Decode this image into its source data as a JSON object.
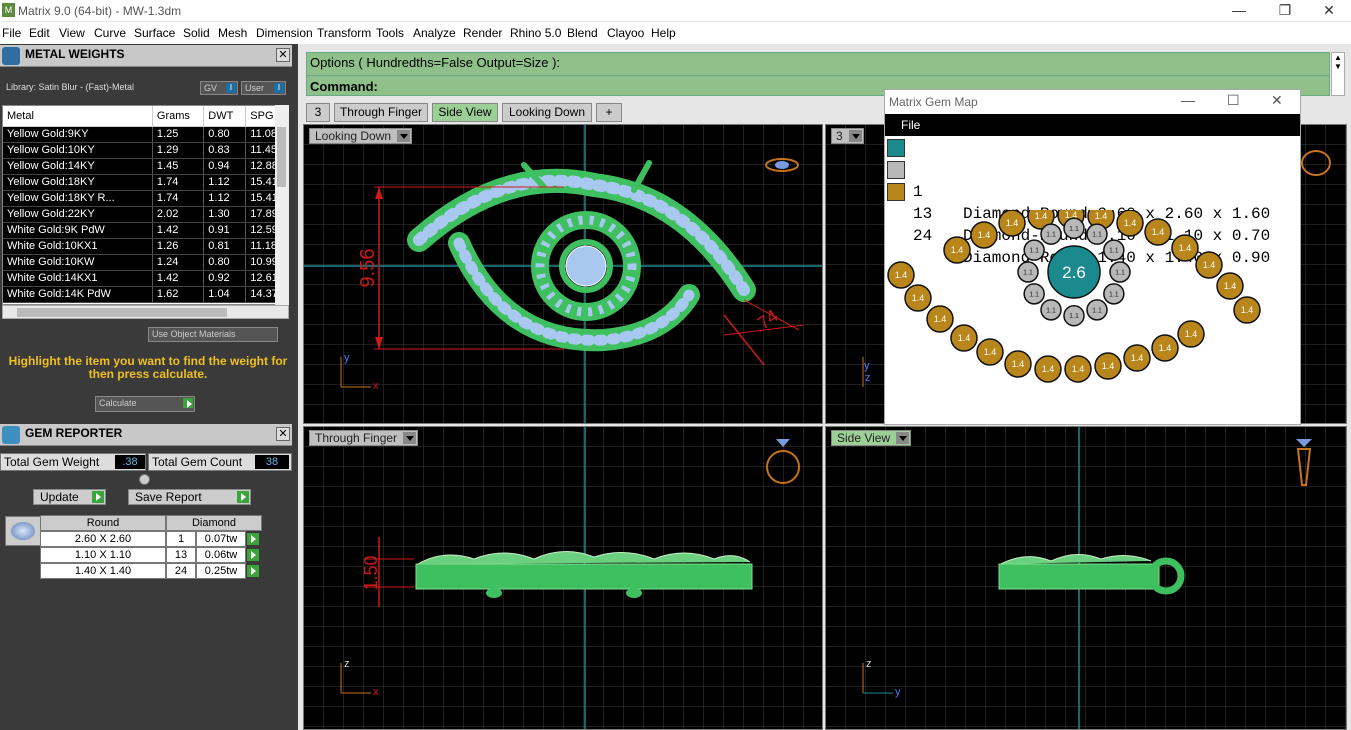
{
  "window": {
    "title": "Matrix 9.0 (64-bit) - MW-1.3dm",
    "minimize": "—",
    "restore": "❐",
    "close": "✕"
  },
  "menu": [
    "File",
    "Edit",
    "View",
    "Curve",
    "Surface",
    "Solid",
    "Mesh",
    "Dimension",
    "Transform",
    "Tools",
    "Analyze",
    "Render",
    "Rhino 5.0",
    "Blend",
    "Clayoo",
    "Help"
  ],
  "metal_panel": {
    "title": "METAL WEIGHTS",
    "library": "Library: Satin Blur - (Fast)-Metal",
    "gv": "GV",
    "user": "User",
    "toggle": "I",
    "columns": [
      "Metal",
      "Grams",
      "DWT",
      "SPG"
    ],
    "rows": [
      [
        "Yellow Gold:9KY",
        "1.25",
        "0.80",
        "11.08"
      ],
      [
        "Yellow Gold:10KY",
        "1.29",
        "0.83",
        "11.45"
      ],
      [
        "Yellow Gold:14KY",
        "1.45",
        "0.94",
        "12.88"
      ],
      [
        "Yellow Gold:18KY",
        "1.74",
        "1.12",
        "15.41"
      ],
      [
        "Yellow Gold:18KY R...",
        "1.74",
        "1.12",
        "15.41"
      ],
      [
        "Yellow Gold:22KY",
        "2.02",
        "1.30",
        "17.89"
      ],
      [
        "White Gold:9K PdW",
        "1.42",
        "0.91",
        "12.59"
      ],
      [
        "White Gold:10KX1",
        "1.26",
        "0.81",
        "11.18"
      ],
      [
        "White Gold:10KW",
        "1.24",
        "0.80",
        "10.99"
      ],
      [
        "White Gold:14KX1",
        "1.42",
        "0.92",
        "12.61"
      ],
      [
        "White Gold:14K PdW",
        "1.62",
        "1.04",
        "14.37"
      ]
    ],
    "use_object_materials": "Use Object Materials",
    "hint": "Highlight the item you want to find the weight for then press calculate.",
    "calculate": "Calculate"
  },
  "gem_panel": {
    "title": "GEM REPORTER",
    "total_weight_label": "Total Gem Weight",
    "total_weight": ".38",
    "total_count_label": "Total Gem Count",
    "total_count": "38",
    "update": "Update",
    "save_report": "Save Report",
    "head_shape": "Round",
    "head_type": "Diamond",
    "rows": [
      {
        "size": "2.60 X 2.60",
        "count": "1",
        "weight": "0.07tw"
      },
      {
        "size": "1.10 X 1.10",
        "count": "13",
        "weight": "0.06tw"
      },
      {
        "size": "1.40 X 1.40",
        "count": "24",
        "weight": "0.25tw"
      }
    ]
  },
  "options": {
    "line1": "Options ( Hundredths=False  Output=Size ):",
    "line2": "Command:"
  },
  "tabs": [
    "3",
    "Through Finger",
    "Side View",
    "Looking Down",
    "+"
  ],
  "viewports": {
    "top_left": {
      "label": "Looking Down",
      "dim1": "9.56",
      "dim2": ".74",
      "axis_h": "x",
      "axis_v": "y"
    },
    "top_right": {
      "label": "3",
      "axis_v": "y",
      "axis_h2": "z"
    },
    "bottom_left": {
      "label": "Through Finger",
      "dim": "1.50",
      "axis_h": "x",
      "axis_v": "z"
    },
    "bottom_right": {
      "label": "Side View",
      "axis_h": "y",
      "axis_v": "z"
    }
  },
  "gem_map": {
    "title": "Matrix Gem Map",
    "menu": "File",
    "legend": [
      {
        "count": "1",
        "desc": "Diamond-Round 2.60 x 2.60 x 1.60",
        "color": "#1a8a8f"
      },
      {
        "count": "13",
        "desc": "Diamond-Round 1.10 x 1.10 x 0.70",
        "color": "#b8b8b8"
      },
      {
        "count": "24",
        "desc": "Diamond-Round 1.40 x 1.40 x 0.90",
        "color": "#b8861a"
      }
    ],
    "center_label": "2.6",
    "small_label": "1.1",
    "outer_label": "1.4"
  }
}
